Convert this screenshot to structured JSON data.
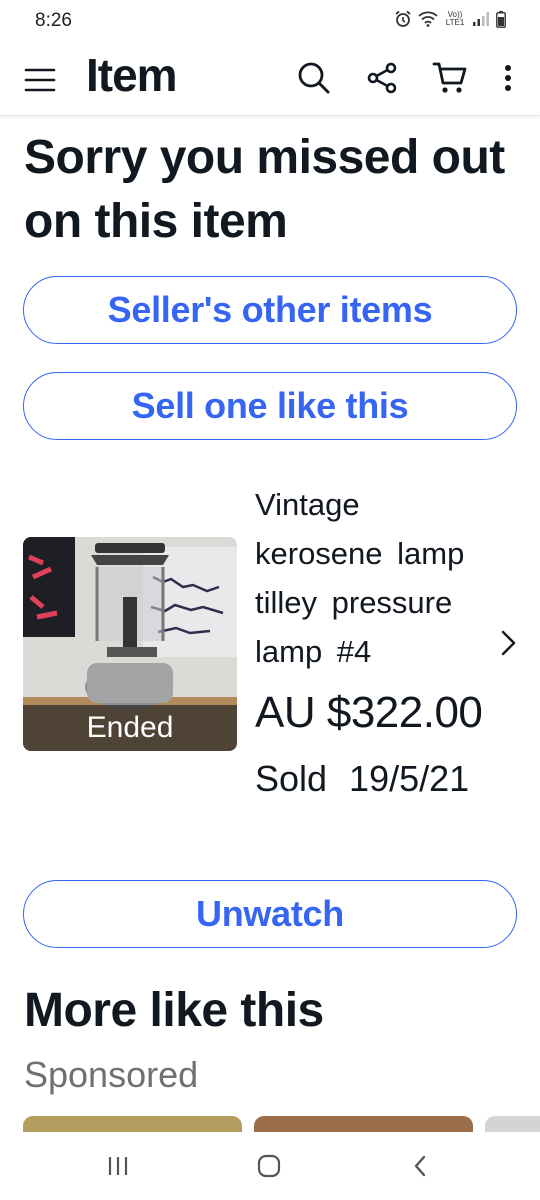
{
  "status_bar": {
    "time": "8:26",
    "network_label": "Vo)) LTE1",
    "icons": [
      "alarm-icon",
      "wifi-icon",
      "signal-icon",
      "battery-icon"
    ]
  },
  "app_bar": {
    "title": "Item",
    "icons": [
      "menu-icon",
      "search-icon",
      "share-icon",
      "cart-icon",
      "more-icon"
    ]
  },
  "heading": "Sorry you missed out on this item",
  "buttons": {
    "seller_items": "Seller's other items",
    "sell_one": "Sell one like this",
    "unwatch": "Unwatch"
  },
  "item": {
    "title": "Vintage kerosene lamp tilley pressure lamp #4",
    "badge": "Ended",
    "price": "AU $322.00",
    "status": "Sold 19/5/21"
  },
  "more_section": {
    "title": "More like this",
    "subtitle": "Sponsored"
  },
  "colors": {
    "accent": "#3665f3",
    "text": "#111820",
    "muted": "#707070"
  }
}
